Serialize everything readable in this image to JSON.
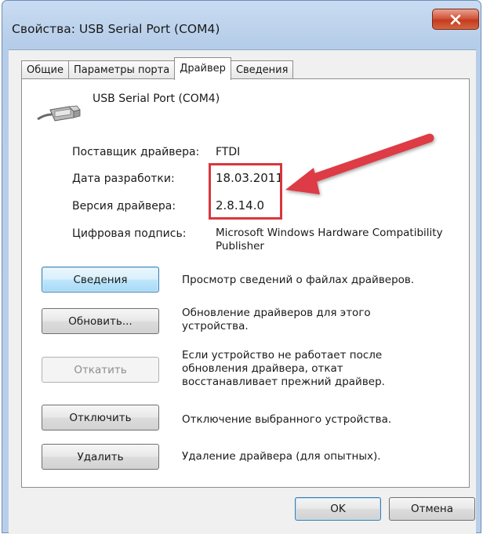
{
  "window": {
    "title": "Свойства: USB Serial Port (COM4)",
    "close_glyph": "x"
  },
  "tabs": [
    {
      "label": "Общие",
      "active": false
    },
    {
      "label": "Параметры порта",
      "active": false
    },
    {
      "label": "Драйвер",
      "active": true
    },
    {
      "label": "Сведения",
      "active": false
    }
  ],
  "device": {
    "icon": "usb-plug-icon",
    "name": "USB Serial Port (COM4)"
  },
  "driver_info": {
    "provider_label": "Поставщик драйвера:",
    "provider_value": "FTDI",
    "date_label": "Дата разработки:",
    "date_value": "18.03.2011",
    "version_label": "Версия драйвера:",
    "version_value": "2.8.14.0",
    "signature_label": "Цифровая подпись:",
    "signature_value_line1": "Microsoft Windows Hardware Compatibility",
    "signature_value_line2": "Publisher"
  },
  "actions": {
    "details": {
      "label": "Сведения",
      "desc1": "Просмотр сведений о файлах драйверов."
    },
    "update": {
      "label": "Обновить...",
      "desc1": "Обновление драйверов для этого",
      "desc2": "устройства."
    },
    "rollback": {
      "label": "Откатить",
      "desc1": "Если устройство не работает после",
      "desc2": "обновления драйвера, откат",
      "desc3": "восстанавливает прежний драйвер."
    },
    "disable": {
      "label": "Отключить",
      "desc1": "Отключение выбранного устройства."
    },
    "uninstall": {
      "label": "Удалить",
      "desc1": "Удаление драйвера (для опытных)."
    }
  },
  "footer": {
    "ok_label": "OK",
    "cancel_label": "Отмена"
  },
  "colors": {
    "annotation_red": "#d9363e",
    "focus_blue": "#3c7fb1"
  }
}
